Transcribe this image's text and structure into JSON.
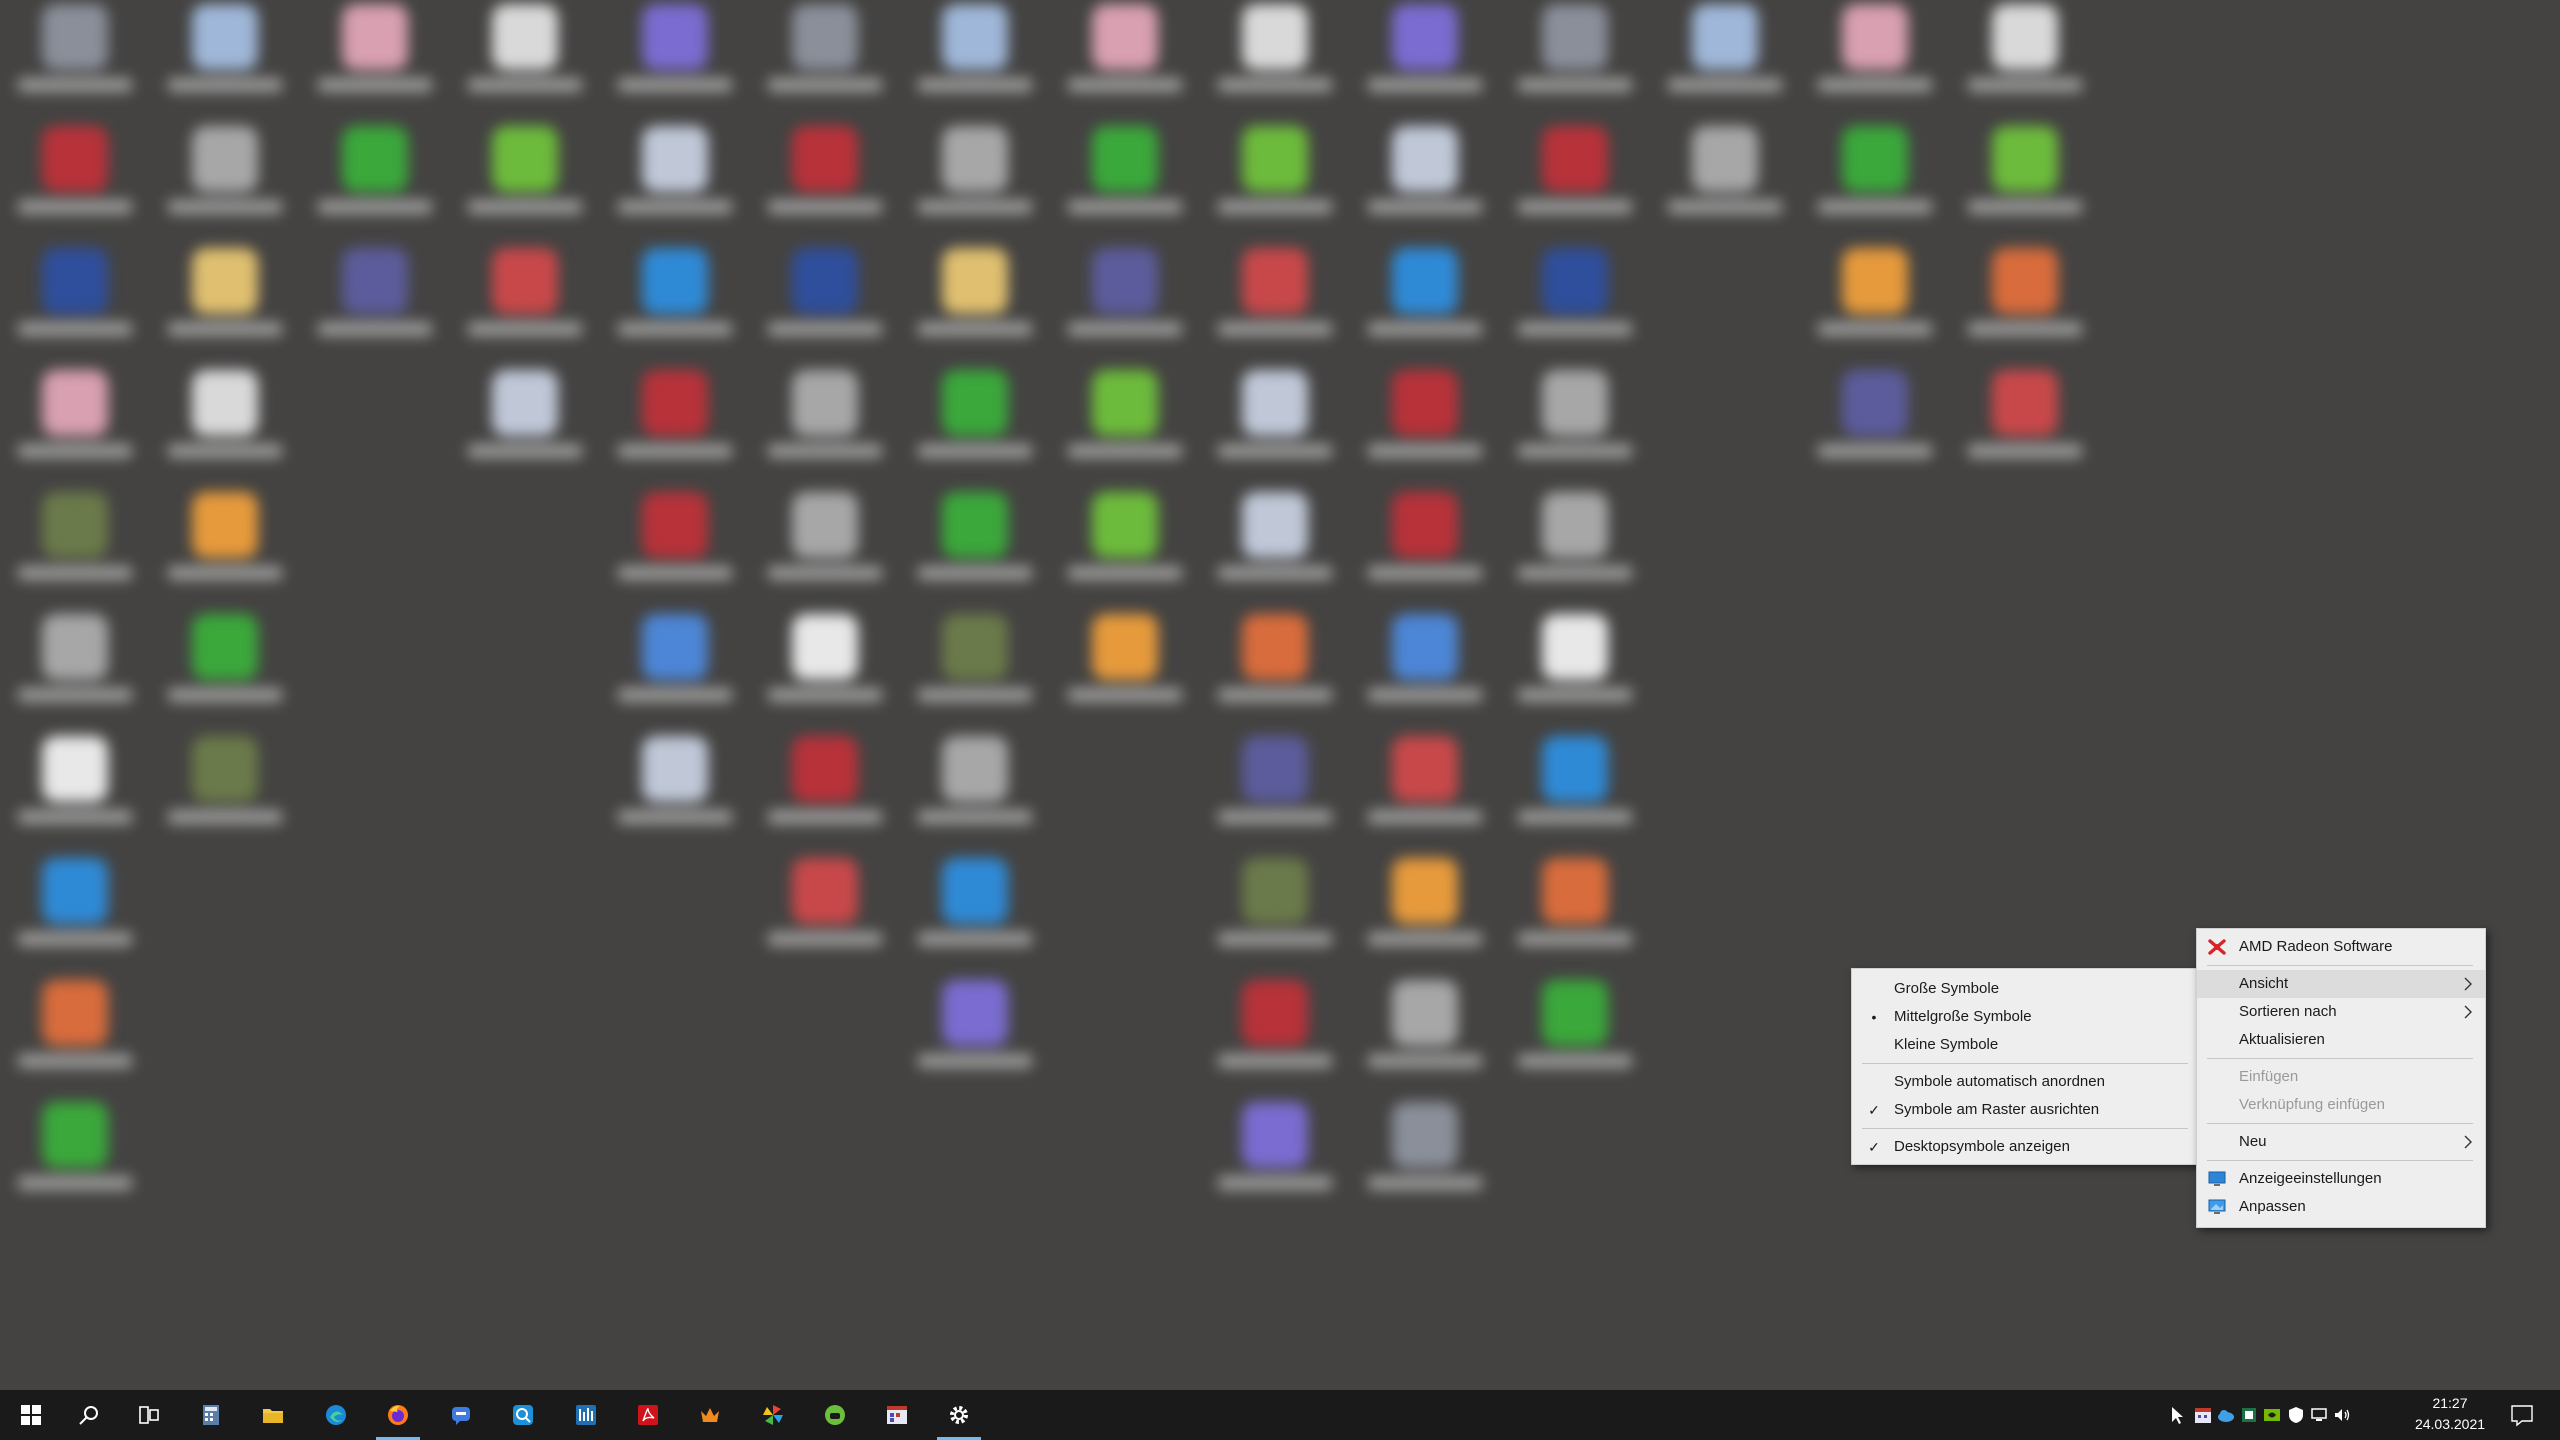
{
  "desktop": {
    "background_color": "#444342"
  },
  "context_menu": {
    "items": [
      {
        "label": "AMD Radeon Software",
        "icon": "amd-radeon-icon"
      },
      {
        "label": "Ansicht",
        "submenu": true,
        "highlighted": true
      },
      {
        "label": "Sortieren nach",
        "submenu": true
      },
      {
        "label": "Aktualisieren"
      },
      {
        "label": "Einfügen",
        "disabled": true
      },
      {
        "label": "Verknüpfung einfügen",
        "disabled": true
      },
      {
        "label": "Neu",
        "submenu": true
      },
      {
        "label": "Anzeigeeinstellungen",
        "icon": "display-settings-icon"
      },
      {
        "label": "Anpassen",
        "icon": "personalize-icon"
      }
    ]
  },
  "view_submenu": {
    "items": [
      {
        "label": "Große Symbole"
      },
      {
        "label": "Mittelgroße Symbole",
        "mark": "•"
      },
      {
        "label": "Kleine Symbole"
      },
      {
        "label": "Symbole automatisch anordnen"
      },
      {
        "label": "Symbole am Raster ausrichten",
        "mark": "✓"
      },
      {
        "label": "Desktopsymbole anzeigen",
        "mark": "✓"
      }
    ]
  },
  "taskbar": {
    "pinned": [
      {
        "name": "start-icon"
      },
      {
        "name": "search-icon"
      },
      {
        "name": "task-view-icon"
      },
      {
        "name": "calculator-icon"
      },
      {
        "name": "file-explorer-icon"
      },
      {
        "name": "edge-icon"
      },
      {
        "name": "firefox-icon",
        "active": true
      },
      {
        "name": "chat-app-icon"
      },
      {
        "name": "search-app-icon"
      },
      {
        "name": "equalizer-app-icon"
      },
      {
        "name": "acrobat-icon"
      },
      {
        "name": "crown-app-icon"
      },
      {
        "name": "pinwheel-app-icon"
      },
      {
        "name": "green-app-icon"
      },
      {
        "name": "media-app-icon"
      },
      {
        "name": "settings-icon",
        "active": true
      }
    ],
    "tray": {
      "time": "21:27",
      "date": "24.03.2021"
    }
  }
}
